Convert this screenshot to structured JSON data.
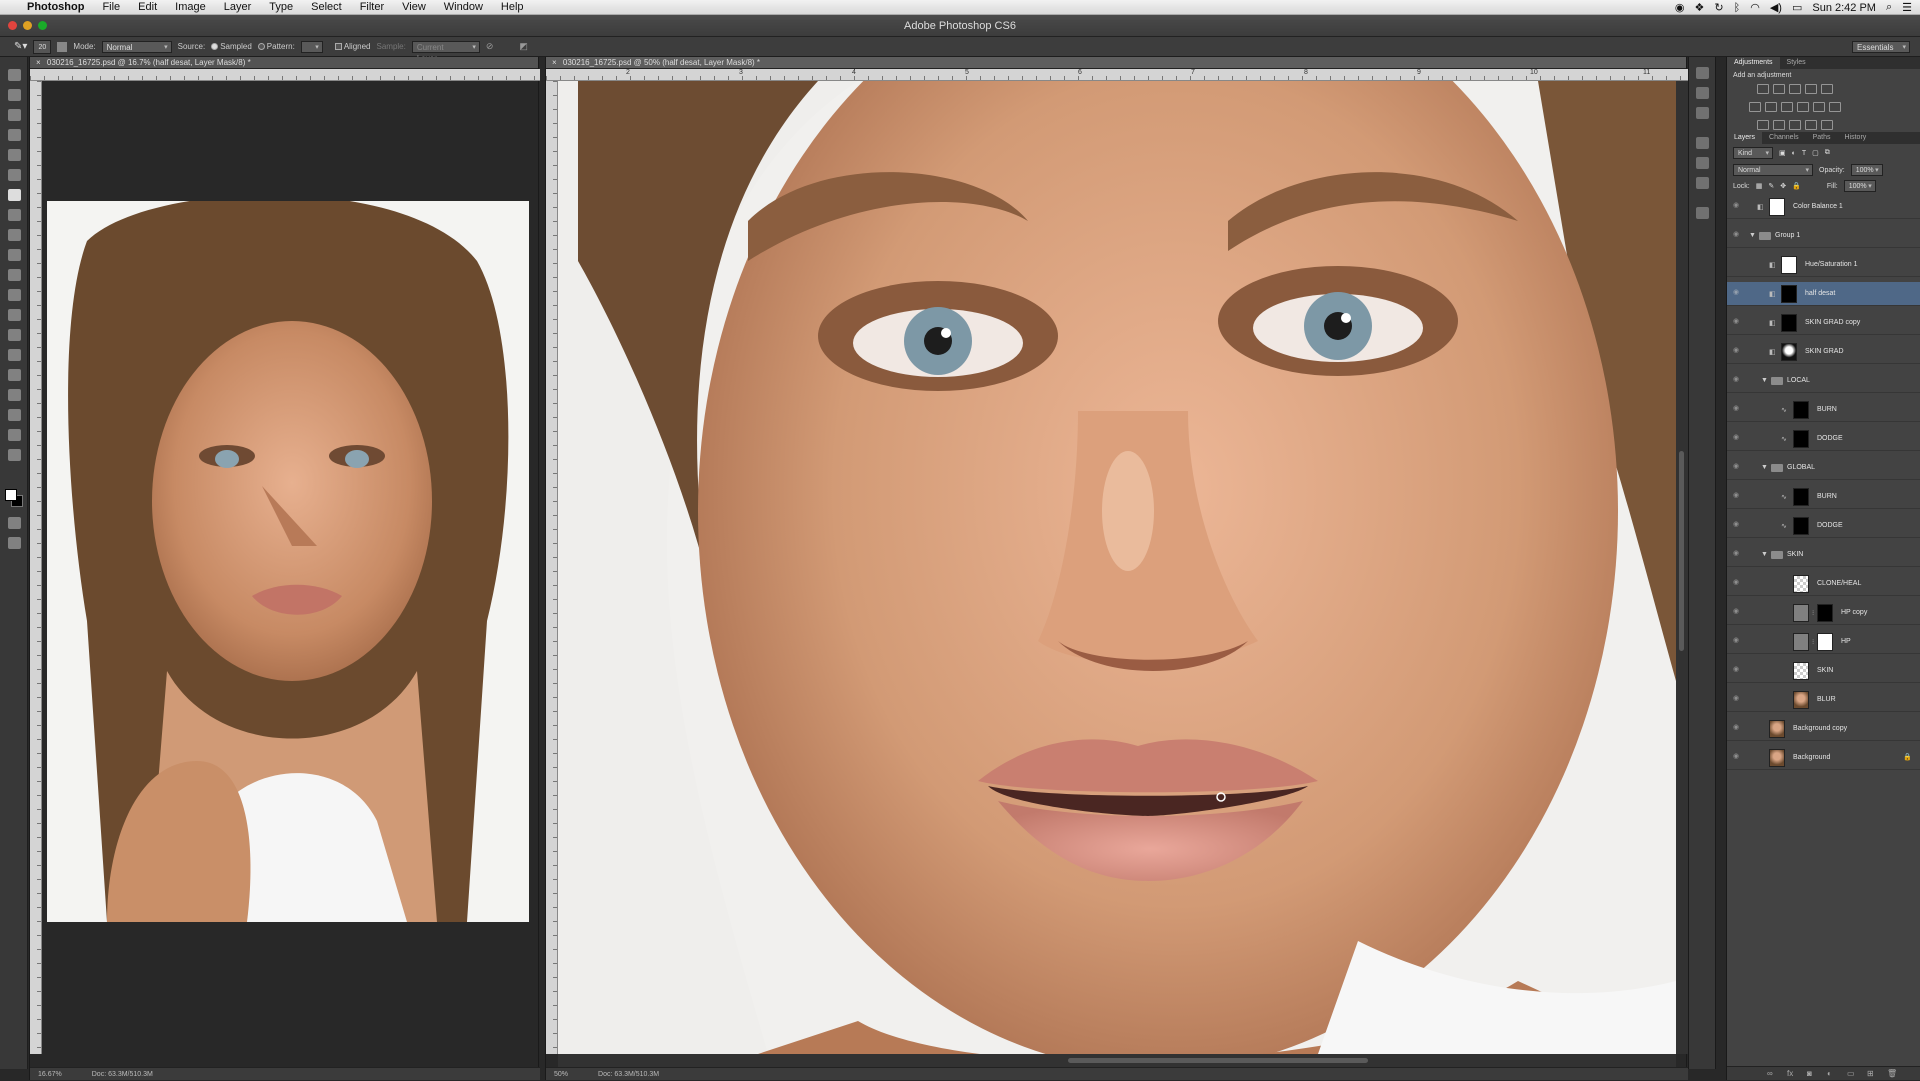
{
  "menubar": {
    "apple": "",
    "app_name": "Photoshop",
    "items": [
      "File",
      "Edit",
      "Image",
      "Layer",
      "Type",
      "Select",
      "Filter",
      "View",
      "Window",
      "Help"
    ],
    "clock": "Sun 2:42 PM"
  },
  "window": {
    "title": "Adobe Photoshop CS6"
  },
  "options": {
    "brush_size": "20",
    "mode_label": "Mode:",
    "mode_value": "Normal",
    "source_label": "Source:",
    "sampled_label": "Sampled",
    "pattern_label": "Pattern:",
    "aligned_label": "Aligned",
    "sample_label": "Sample:",
    "sample_value": "Current Layer",
    "workspace": "Essentials"
  },
  "doc_left": {
    "tab": "030216_16725.psd @ 16.7% (half desat, Layer Mask/8) *",
    "zoom": "16.67%",
    "doc_info": "Doc: 63.3M/510.3M"
  },
  "doc_right": {
    "tab": "030216_16725.psd @ 50% (half desat, Layer Mask/8) *",
    "zoom": "50%",
    "doc_info": "Doc: 63.3M/510.3M",
    "ruler_marks": [
      "2",
      "3",
      "4",
      "5",
      "6",
      "7",
      "8",
      "9",
      "10",
      "11"
    ]
  },
  "adjustments": {
    "tabs": [
      "Adjustments",
      "Styles"
    ],
    "heading": "Add an adjustment"
  },
  "layers_panel": {
    "tabs": [
      "Layers",
      "Channels",
      "Paths",
      "History"
    ],
    "kind": "Kind",
    "blend_mode": "Normal",
    "opacity_label": "Opacity:",
    "opacity_value": "100%",
    "lock_label": "Lock:",
    "fill_label": "Fill:",
    "fill_value": "100%",
    "layers": [
      {
        "name": "Color Balance 1",
        "type": "adjustment",
        "indent": 0,
        "selected": false,
        "visible": true
      },
      {
        "name": "Group 1",
        "type": "group",
        "indent": 0,
        "selected": false,
        "visible": true
      },
      {
        "name": "Hue/Saturation 1",
        "type": "adjustment",
        "indent": 1,
        "selected": false,
        "visible": false
      },
      {
        "name": "half desat",
        "type": "adjustment",
        "indent": 1,
        "selected": true,
        "visible": true
      },
      {
        "name": "SKIN GRAD copy",
        "type": "adjustment",
        "indent": 1,
        "selected": false,
        "visible": true
      },
      {
        "name": "SKIN GRAD",
        "type": "adjustment",
        "indent": 1,
        "selected": false,
        "visible": true
      },
      {
        "name": "LOCAL",
        "type": "group",
        "indent": 1,
        "selected": false,
        "visible": true
      },
      {
        "name": "BURN",
        "type": "curve",
        "indent": 2,
        "selected": false,
        "visible": true
      },
      {
        "name": "DODGE",
        "type": "curve",
        "indent": 2,
        "selected": false,
        "visible": true
      },
      {
        "name": "GLOBAL",
        "type": "group",
        "indent": 1,
        "selected": false,
        "visible": true
      },
      {
        "name": "BURN",
        "type": "curve",
        "indent": 2,
        "selected": false,
        "visible": true
      },
      {
        "name": "DODGE",
        "type": "curve",
        "indent": 2,
        "selected": false,
        "visible": true
      },
      {
        "name": "SKIN",
        "type": "group",
        "indent": 1,
        "selected": false,
        "visible": true
      },
      {
        "name": "CLONE/HEAL",
        "type": "pixel",
        "indent": 2,
        "selected": false,
        "visible": true
      },
      {
        "name": "HP copy",
        "type": "pixelmask",
        "indent": 2,
        "selected": false,
        "visible": true
      },
      {
        "name": "HP",
        "type": "pixelmask",
        "indent": 2,
        "selected": false,
        "visible": true
      },
      {
        "name": "SKIN",
        "type": "pixel",
        "indent": 2,
        "selected": false,
        "visible": true
      },
      {
        "name": "BLUR",
        "type": "photo",
        "indent": 2,
        "selected": false,
        "visible": true
      },
      {
        "name": "Background copy",
        "type": "photo",
        "indent": 0,
        "selected": false,
        "visible": true
      },
      {
        "name": "Background",
        "type": "photo",
        "indent": 0,
        "selected": false,
        "visible": true,
        "locked": true
      }
    ]
  }
}
